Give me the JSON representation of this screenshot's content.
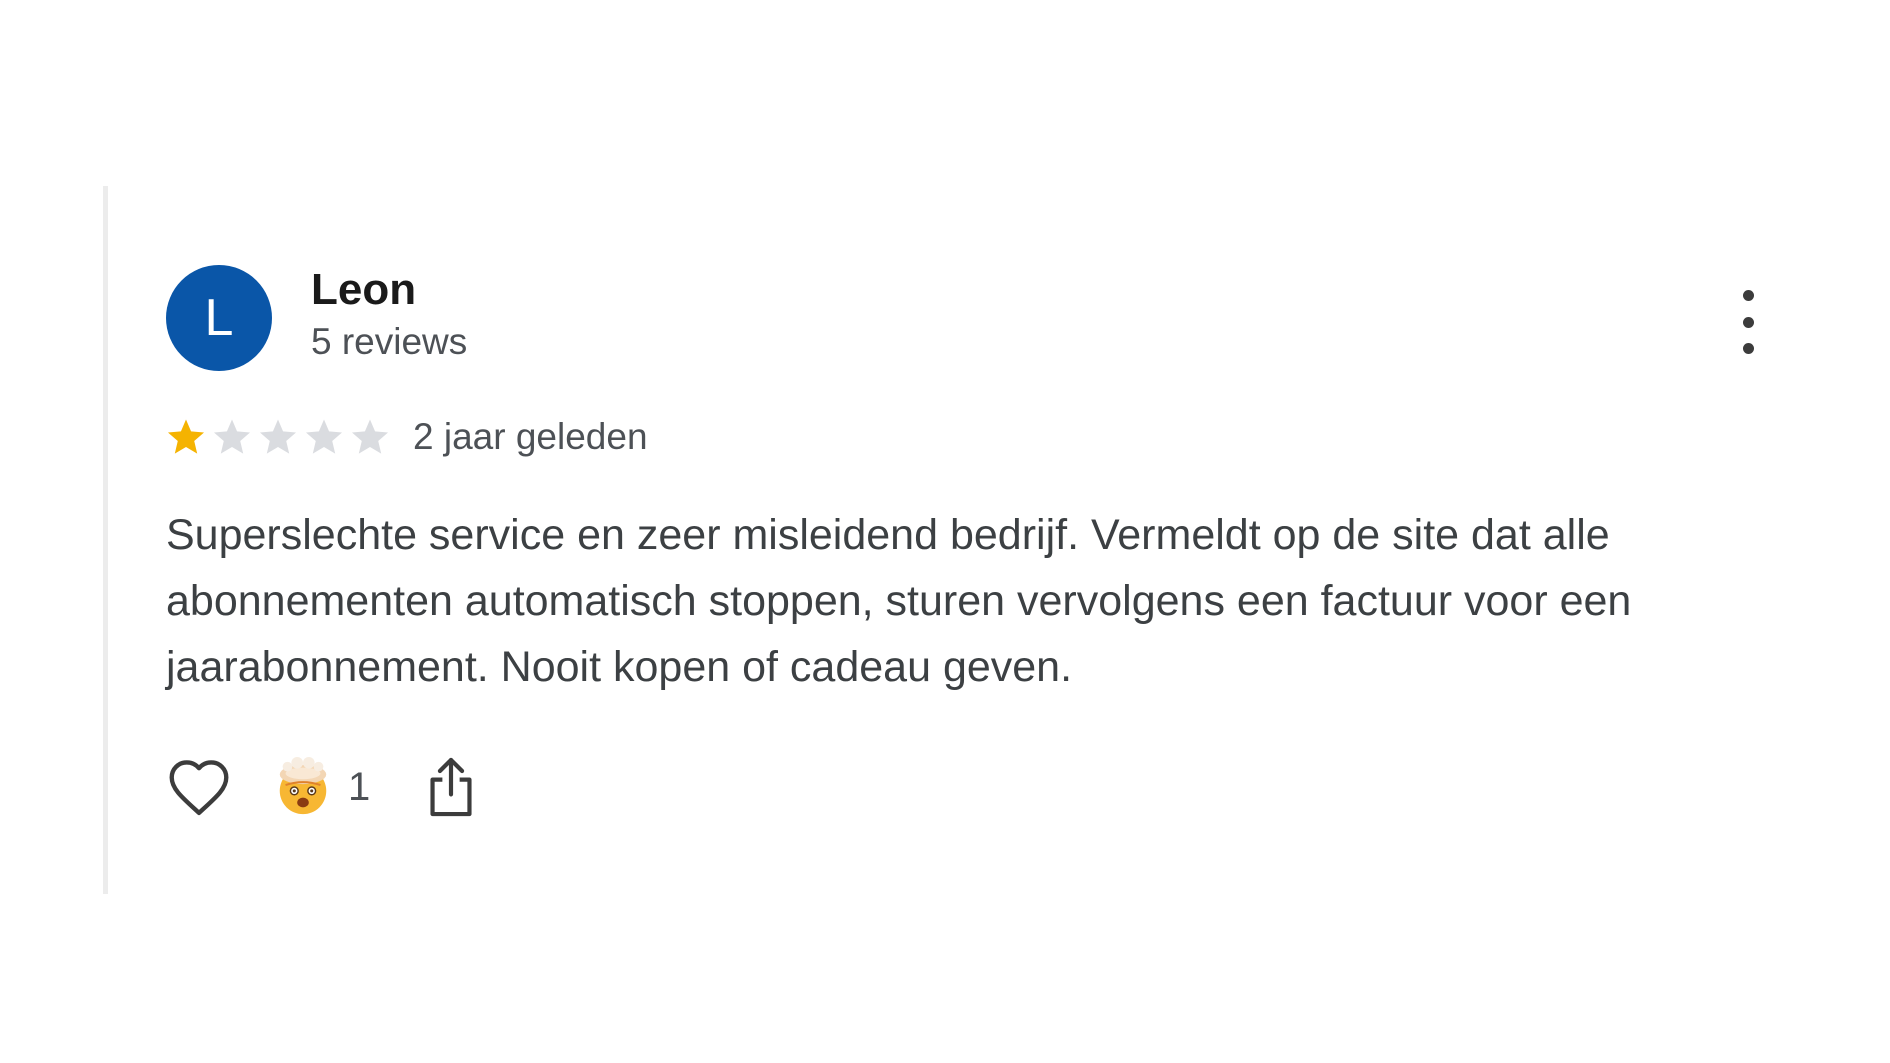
{
  "reviewer": {
    "initial": "L",
    "name": "Leon",
    "review_count": "5 reviews",
    "avatar_color": "#0a56a8"
  },
  "review": {
    "rating": 1,
    "max_rating": 5,
    "date": "2 jaar geleden",
    "text": "Superslechte service en zeer misleidend bedrijf. Vermeldt op de site dat alle abonnementen automatisch stoppen, sturen vervolgens een factuur voor een jaarabonnement. Nooit kopen of cadeau geven."
  },
  "colors": {
    "star_filled": "#f5b301",
    "star_empty": "#dadce0"
  },
  "actions": {
    "like_icon": "heart-icon",
    "reaction_icon": "exploding-head-emoji-icon",
    "reaction_count": "1",
    "share_icon": "share-icon"
  }
}
